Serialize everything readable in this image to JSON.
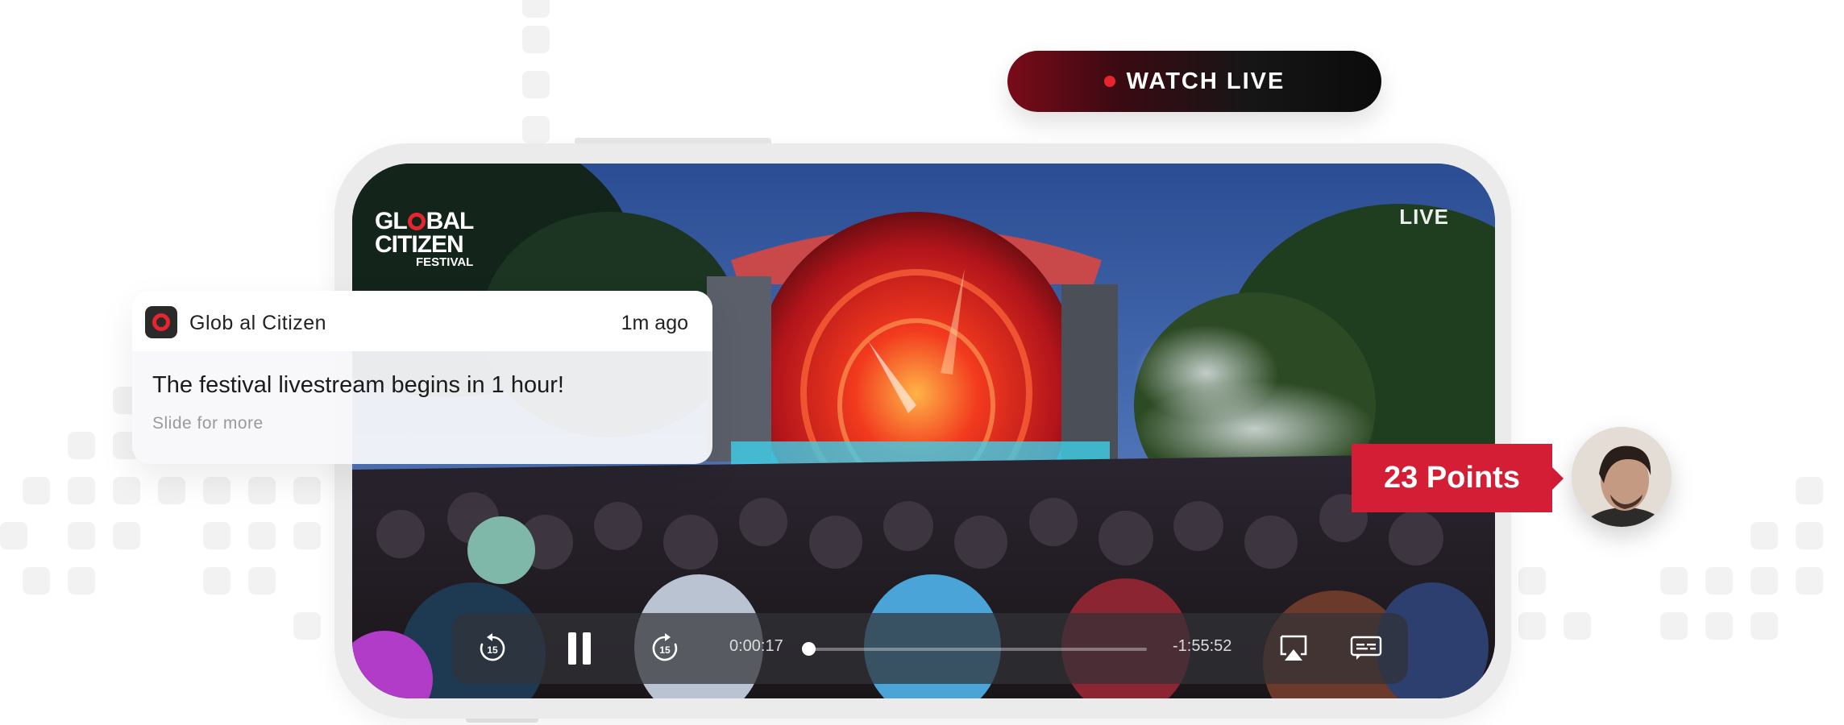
{
  "watch_live": {
    "label": "WATCH LIVE",
    "dot_color": "#e5252f"
  },
  "video": {
    "brand_logo": {
      "line1_pre": "GL",
      "line1_post": "BAL",
      "line2": "CITIZEN",
      "line3": "FESTIVAL"
    },
    "live_badge": "LIVE",
    "scene": "concert-stage-crowd"
  },
  "player": {
    "elapsed": "0:00:17",
    "remaining": "-1:55:52",
    "progress": 0.004,
    "buttons": {
      "skip_back_icon": "rewind-15-icon",
      "pause_icon": "pause-icon",
      "skip_forward_icon": "forward-15-icon",
      "airplay_icon": "airplay-icon",
      "captions_icon": "captions-icon"
    },
    "skip_seconds": "15"
  },
  "notification": {
    "app_name": "Glob al Citizen",
    "time": "1m ago",
    "message": "The festival livestream begins in 1 hour!",
    "hint": "Slide for more"
  },
  "reward": {
    "label": "23 Points",
    "color": "#d31e35"
  }
}
